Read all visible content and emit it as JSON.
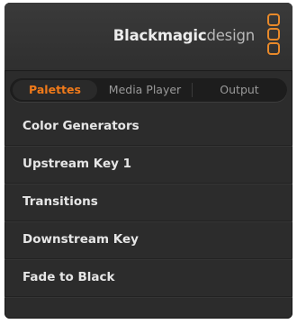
{
  "brand": {
    "name_part1": "Blackmagic",
    "name_part2": "design",
    "accent_color": "#e8892a"
  },
  "tabs": [
    {
      "label": "Palettes",
      "active": true
    },
    {
      "label": "Media Player",
      "active": false
    },
    {
      "label": "Output",
      "active": false
    }
  ],
  "palettes": [
    {
      "label": "Color Generators"
    },
    {
      "label": "Upstream Key 1"
    },
    {
      "label": "Transitions"
    },
    {
      "label": "Downstream Key"
    },
    {
      "label": "Fade to Black"
    }
  ]
}
